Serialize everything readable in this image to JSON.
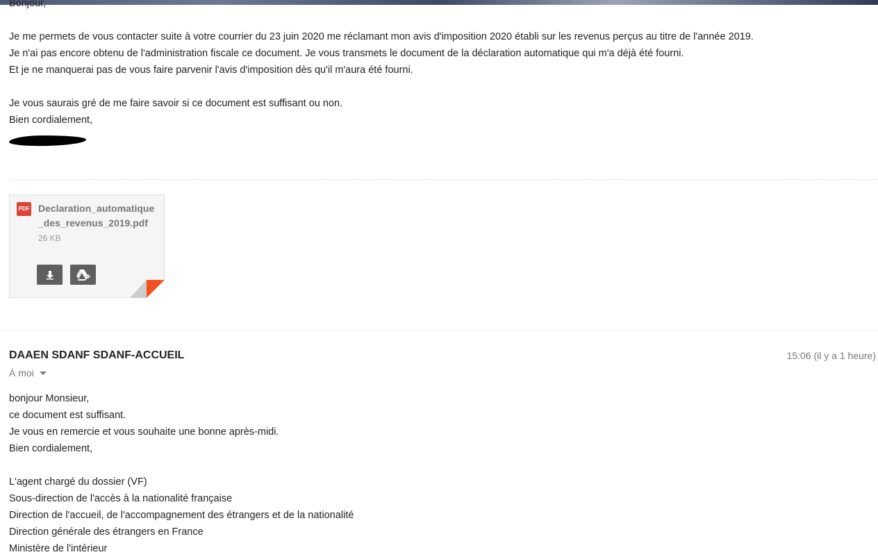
{
  "first_message": {
    "lines": [
      "Bonjour,",
      "",
      "Je me permets de vous contacter suite à votre courrier du 23 juin 2020 me réclamant mon avis d'imposition 2020 établi sur les revenus perçus au titre de l'année 2019.",
      "Je n'ai pas encore obtenu de l'administration fiscale ce document. Je vous transmets le document de la déclaration automatique qui m'a déjà été fourni.",
      "Et je ne manquerai pas de vous faire parvenir l'avis d'imposition dès qu'il m'aura été fourni.",
      "",
      "Je vous saurais gré de me faire savoir si ce document est suffisant ou non.",
      "Bien cordialement,"
    ]
  },
  "attachment": {
    "type_label": "PDF",
    "filename": "Declaration_automatique_des_revenus_2019.pdf",
    "size": "26 KB",
    "actions": [
      "download-icon",
      "drive-add-icon"
    ]
  },
  "second_message": {
    "sender": "DAAEN SDANF SDANF-ACCUEIL",
    "timestamp": "15:06 (il y a 1 heure)",
    "recipient": "À moi",
    "lines": [
      "bonjour Monsieur,",
      "ce document est suffisant.",
      "Je vous en remercie et vous souhaite une bonne après-midi.",
      "Bien cordialement,",
      "",
      "L'agent chargé du dossier (VF)",
      "Sous-direction de l'accès à la nationalité française",
      "Direction de l'accueil, de l'accompagnement des étrangers et de la nationalité",
      "Direction générale des étrangers en France",
      "Ministère de l'intérieur"
    ]
  },
  "colors": {
    "text": "#222222",
    "muted": "#777777",
    "pdf_red": "#db4437",
    "button_gray": "#5f5f5f",
    "fold_orange": "#f4511e"
  }
}
